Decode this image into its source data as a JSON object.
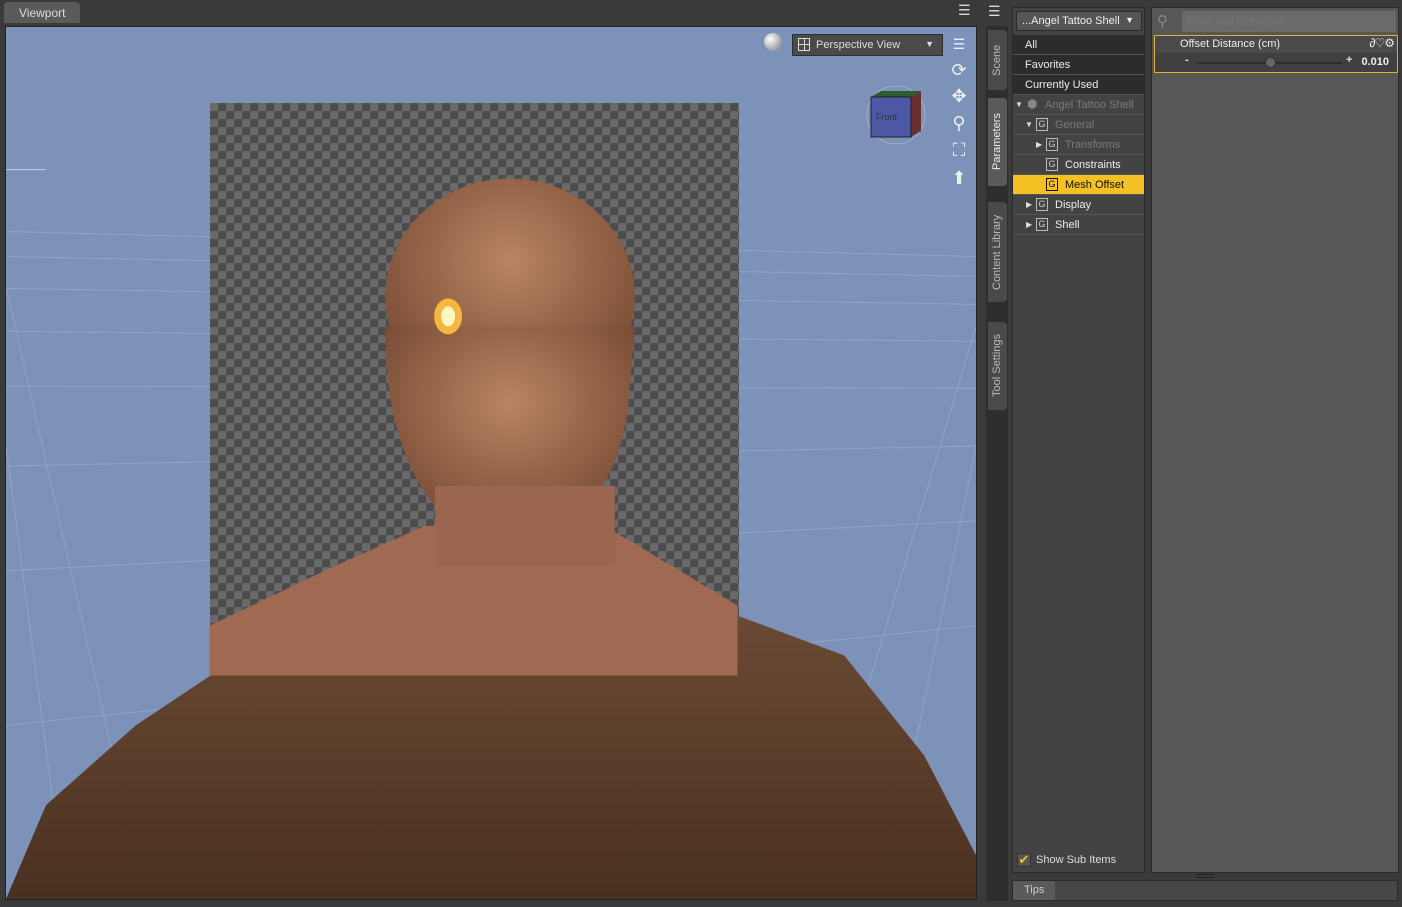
{
  "viewport": {
    "tab_label": "Viewport",
    "view_dropdown": "Perspective View",
    "cube_label": "Front",
    "nav_icons": [
      "orbit-icon",
      "pan-icon",
      "zoom-icon",
      "frame-icon",
      "reset-view-icon"
    ]
  },
  "side_tabs": [
    "Scene",
    "Parameters",
    "Content Library",
    "Tool Settings"
  ],
  "parameters": {
    "node_dropdown": "...Angel Tattoo Shell",
    "categories": [
      "All",
      "Favorites",
      "Currently Used"
    ],
    "tree": [
      {
        "label": "Angel Tattoo Shell",
        "level": 0,
        "expanded": true,
        "dim": true
      },
      {
        "label": "General",
        "level": 1,
        "expanded": true,
        "dim": true
      },
      {
        "label": "Transforms",
        "level": 2,
        "expanded": false,
        "dim": true
      },
      {
        "label": "Constraints",
        "level": 2
      },
      {
        "label": "Mesh Offset",
        "level": 2,
        "selected": true
      },
      {
        "label": "Display",
        "level": 1,
        "expanded": false
      },
      {
        "label": "Shell",
        "level": 1,
        "expanded": false
      }
    ],
    "show_sub_items": "Show Sub Items",
    "filter_placeholder": "Enter text to filter by...",
    "param_name": "Offset Distance (cm)",
    "param_value": "0.010",
    "slider_fraction": 0.5,
    "minus": "-",
    "plus": "+"
  },
  "tips_tab": "Tips",
  "colors": {
    "accent": "#f5c024",
    "viewport_bg": "#7d92b8"
  }
}
